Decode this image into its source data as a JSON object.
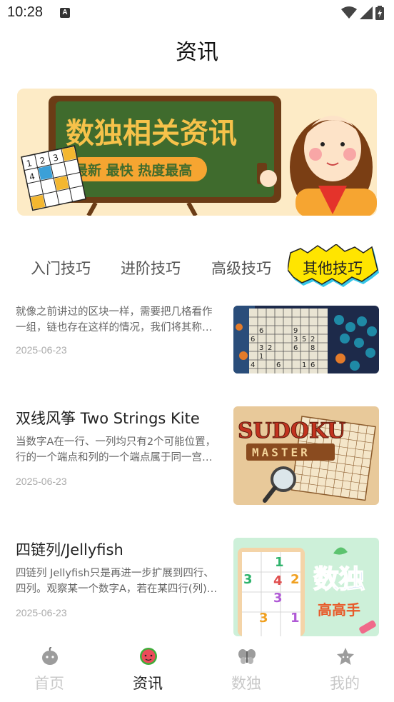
{
  "status_bar": {
    "time": "10:28",
    "notif": "A"
  },
  "header": {
    "title": "资讯"
  },
  "banner": {
    "headline": "数独相关资讯",
    "subline": "最新 最快 热度最高",
    "grid_digits": [
      "1",
      "2",
      "3",
      "4"
    ]
  },
  "tabs": [
    {
      "label": "入门技巧",
      "active": false
    },
    {
      "label": "进阶技巧",
      "active": false
    },
    {
      "label": "高级技巧",
      "active": false
    },
    {
      "label": "其他技巧",
      "active": true
    }
  ],
  "articles": [
    {
      "title": "",
      "summary_line1": "就像之前讲过的区块一样，需要把几格看作",
      "summary_line2": "一组，链也存在这样的情况，我们将其称…",
      "date": "2025-06-23",
      "thumb_icon": "sudoku-grid-board-icon",
      "grid_digits": [
        "6",
        "9",
        "6",
        "3",
        "5",
        "2",
        "3",
        "2",
        "6",
        "8",
        "1",
        "4",
        "6",
        "1",
        "6"
      ]
    },
    {
      "title": "双线风筝 Two Strings Kite",
      "summary_line1": "当数字A在一行、一列均只有2个可能位置，",
      "summary_line2": "行的一个端点和列的一个端点属于同一宫…",
      "date": "2025-06-23",
      "thumb_icon": "sudoku-master-icon",
      "logo_text": "SUDOKU",
      "logo_subtext": "MASTER"
    },
    {
      "title": "四链列/Jellyfish",
      "summary_line1": "四链列 Jellyfish只是再进一步扩展到四行、",
      "summary_line2": "四列。观察某一个数字A，若在某四行(列)…",
      "date": "2025-06-23",
      "thumb_icon": "sudoku-master-app-icon",
      "logo_text": "数独",
      "logo_subtext": "高高手",
      "grid_digits": [
        "1",
        "3",
        "4",
        "2",
        "3",
        "3",
        "1"
      ]
    }
  ],
  "bottom_nav": [
    {
      "label": "首页",
      "icon": "home-fruit-icon",
      "active": false
    },
    {
      "label": "资讯",
      "icon": "news-watermelon-icon",
      "active": true
    },
    {
      "label": "数独",
      "icon": "sudoku-butterfly-icon",
      "active": false
    },
    {
      "label": "我的",
      "icon": "profile-star-icon",
      "active": false
    }
  ],
  "colors": {
    "banner_bg": "#fdebc6",
    "chalkboard": "#3f6b2d",
    "chalk_text": "#f6c24a",
    "tab_highlight": "#ffe500",
    "tab_highlight_shadow": "#36c6e8"
  }
}
